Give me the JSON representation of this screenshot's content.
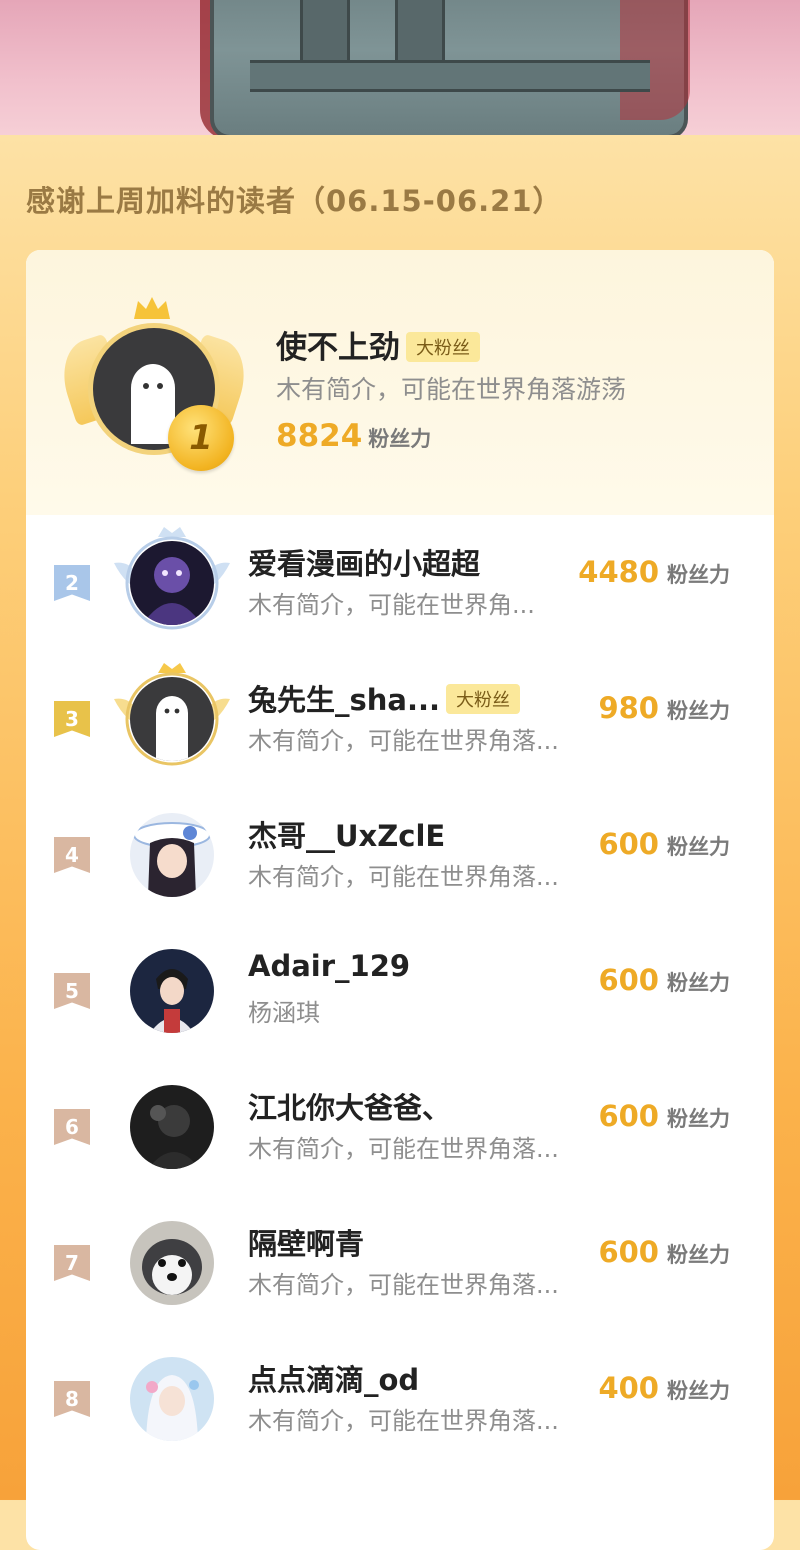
{
  "header": {
    "title": "感谢上周加料的读者（06.15-06.21）"
  },
  "top": {
    "rank": "1",
    "name": "使不上劲",
    "badge": "大粉丝",
    "bio": "木有简介，可能在世界角落游荡",
    "score": "8824",
    "unit": "粉丝力"
  },
  "rows": [
    {
      "rank": "2",
      "name": "爱看漫画的小超超",
      "badge": "",
      "bio": "木有简介，可能在世界角...",
      "score": "4480",
      "unit": "粉丝力",
      "flag_color": "#a9c6e9",
      "avatar": "purple-character-icon"
    },
    {
      "rank": "3",
      "name": "兔先生_sha...",
      "badge": "大粉丝",
      "bio": "木有简介，可能在世界角落...",
      "score": "980",
      "unit": "粉丝力",
      "flag_color": "#e8c24a",
      "avatar": "ghost-icon"
    },
    {
      "rank": "4",
      "name": "杰哥__UxZclE",
      "badge": "",
      "bio": "木有简介，可能在世界角落...",
      "score": "600",
      "unit": "粉丝力",
      "flag_color": "#d9b7a1",
      "avatar": "anime-girl-hat-icon"
    },
    {
      "rank": "5",
      "name": "Adair_129",
      "badge": "",
      "bio": "杨涵琪",
      "score": "600",
      "unit": "粉丝力",
      "flag_color": "#d9b7a1",
      "avatar": "anime-boy-icon"
    },
    {
      "rank": "6",
      "name": "江北你大爸爸、",
      "badge": "",
      "bio": "木有简介，可能在世界角落...",
      "score": "600",
      "unit": "粉丝力",
      "flag_color": "#d9b7a1",
      "avatar": "dark-photo-icon"
    },
    {
      "rank": "7",
      "name": "隔壁啊青",
      "badge": "",
      "bio": "木有简介，可能在世界角落...",
      "score": "600",
      "unit": "粉丝力",
      "flag_color": "#d9b7a1",
      "avatar": "husky-dog-icon"
    },
    {
      "rank": "8",
      "name": "点点滴滴_od",
      "badge": "",
      "bio": "木有简介，可能在世界角落...",
      "score": "400",
      "unit": "粉丝力",
      "flag_color": "#d9b7a1",
      "avatar": "white-hair-girl-icon"
    }
  ],
  "colors": {
    "score": "#eeaa26",
    "accent_bg": "#fdcf7a",
    "badge_bg": "#fbe89a"
  }
}
